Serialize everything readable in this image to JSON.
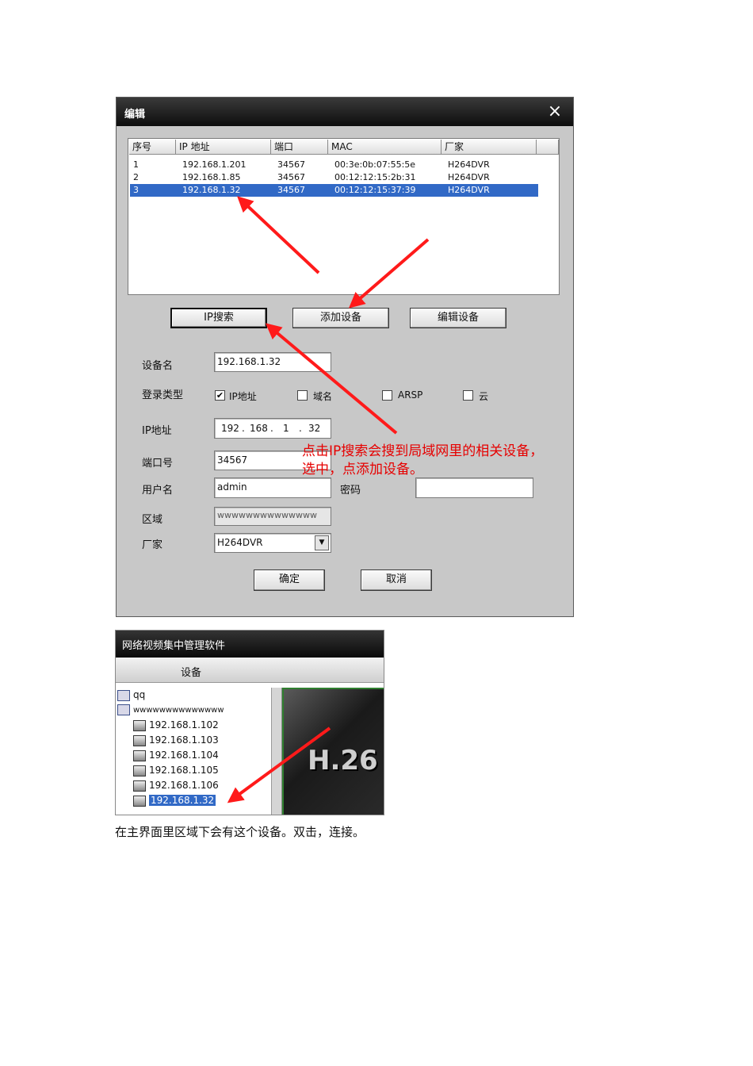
{
  "dialog": {
    "title": "编辑",
    "close_icon": "×",
    "table": {
      "headers": [
        "序号",
        "IP 地址",
        "端口",
        "MAC",
        "厂家"
      ],
      "rows": [
        [
          "1",
          "192.168.1.201",
          "34567",
          "00:3e:0b:07:55:5e",
          "H264DVR"
        ],
        [
          "2",
          "192.168.1.85",
          "34567",
          "00:12:12:15:2b:31",
          "H264DVR"
        ],
        [
          "3",
          "192.168.1.32",
          "34567",
          "00:12:12:15:37:39",
          "H264DVR"
        ]
      ],
      "selected_row": 3
    },
    "buttons": {
      "ip_search": "IP搜索",
      "add_device": "添加设备",
      "edit_device": "编辑设备",
      "ok": "确定",
      "cancel": "取消"
    },
    "form": {
      "device_name_label": "设备名",
      "device_name_value": "192.168.1.32",
      "login_type_label": "登录类型",
      "login_types": [
        {
          "label": "IP地址",
          "checked": true
        },
        {
          "label": "域名",
          "checked": false
        },
        {
          "label": "ARSP",
          "checked": false
        },
        {
          "label": "云",
          "checked": false
        }
      ],
      "ip_label": "IP地址",
      "ip_octets": [
        "192",
        "168",
        "1",
        "32"
      ],
      "ip_dot": ".",
      "port_label": "端口号",
      "port_value": "34567",
      "user_label": "用户名",
      "user_value": "admin",
      "password_label": "密码",
      "password_value": "",
      "region_label": "区域",
      "region_value": "wwwwwwwwwwwwww",
      "vendor_label": "厂家",
      "vendor_value": "H264DVR",
      "vendor_dropdown_icon": "▼"
    },
    "annotation": {
      "line1": "点击IP搜索会搜到局域网里的相关设备，",
      "line2": "选中，点添加设备。",
      "color": "#e60000"
    }
  },
  "main_window": {
    "title": "网络视频集中管理软件",
    "tab": "设备",
    "tree": [
      {
        "label": "qq",
        "level": 0
      },
      {
        "label": "wwwwwwwwwwwwww",
        "level": 0
      },
      {
        "label": "192.168.1.102",
        "level": 1
      },
      {
        "label": "192.168.1.103",
        "level": 1
      },
      {
        "label": "192.168.1.104",
        "level": 1
      },
      {
        "label": "192.168.1.105",
        "level": 1
      },
      {
        "label": "192.168.1.106",
        "level": 1
      },
      {
        "label": "192.168.1.32",
        "level": 1,
        "selected": true
      }
    ],
    "video_logo": "H.26"
  },
  "caption": "在主界面里区域下会有这个设备。双击，连接。",
  "colors": {
    "arrow": "#ff1a1a",
    "selection": "#3169c6"
  }
}
